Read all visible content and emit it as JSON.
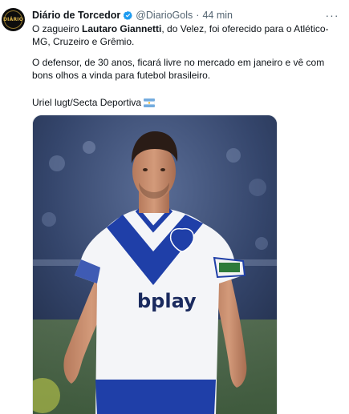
{
  "tweet": {
    "avatar_text": "DIÁRIO",
    "author_name": "Diário de Torcedor",
    "handle": "@DiarioGols",
    "separator": "·",
    "time": "44 min",
    "more_label": "···",
    "text": {
      "p1_before": "O zagueiro ",
      "p1_bold": "Lautaro Giannetti",
      "p1_after": ", do Velez, foi oferecido para o Atlético-MG, Cruzeiro e Grêmio.",
      "p2": "O defensor, de 30 anos, ficará livre no mercado em janeiro e vê com bons olhos a vinda para futebol brasileiro.",
      "p3": "Uriel lugt/Secta Deportiva"
    },
    "media": {
      "sponsor_text": "bplay"
    }
  },
  "colors": {
    "verified": "#1d9bf0",
    "muted": "#536471",
    "kit_blue": "#1f3fa8"
  },
  "icons": {
    "verified": "verified-badge-icon",
    "more": "more-icon",
    "flag": "argentina-flag-icon"
  }
}
